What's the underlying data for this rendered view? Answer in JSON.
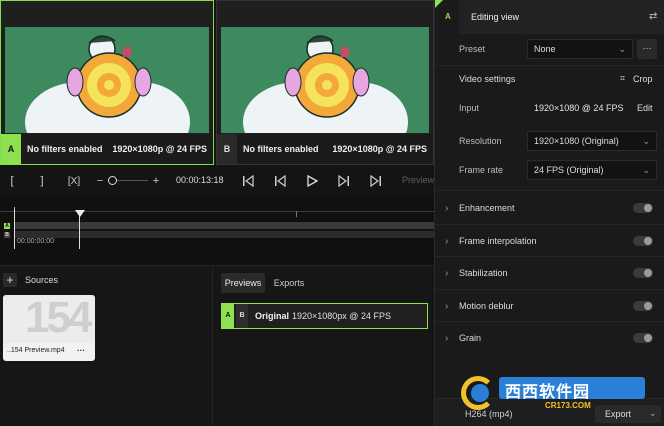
{
  "preview_a": {
    "badge": "A",
    "status": "No filters enabled",
    "resolution": "1920×1080p @ 24 FPS"
  },
  "preview_b": {
    "badge": "B",
    "status": "No filters enabled",
    "resolution": "1920×1080p @ 24 FPS"
  },
  "transport": {
    "in_label": "[",
    "out_label": "]",
    "clear_label": "[X]",
    "zoom_minus": "−",
    "zoom_plus": "+",
    "timecode": "00:00:13:18",
    "preview_label": "Preview"
  },
  "timeline": {
    "track_a": "A",
    "track_b": "B",
    "timecode": "00:00:00:00"
  },
  "sources": {
    "add_label": "+",
    "title": "Sources",
    "thumb_text": "154",
    "file_name": "..154 Preview.mp4",
    "more_label": "···"
  },
  "previews_panel": {
    "tabs": [
      "Previews",
      "Exports"
    ],
    "item": {
      "badge_a": "A",
      "badge_b": "B",
      "name": "Original",
      "resolution": "1920×1080px @ 24 FPS"
    }
  },
  "editing": {
    "badge": "A",
    "title": "Editing view",
    "preset_label": "Preset",
    "preset_value": "None",
    "more_label": "···",
    "video_settings_label": "Video settings",
    "crop_label": "Crop",
    "input_label": "Input",
    "input_value": "1920×1080 @ 24 FPS",
    "edit_label": "Edit",
    "resolution_label": "Resolution",
    "resolution_value": "1920×1080 (Original)",
    "framerate_label": "Frame rate",
    "framerate_value": "24 FPS (Original)",
    "sections": [
      {
        "label": "Enhancement",
        "enabled": false
      },
      {
        "label": "Frame interpolation",
        "enabled": false
      },
      {
        "label": "Stabilization",
        "enabled": false
      },
      {
        "label": "Motion deblur",
        "enabled": false
      },
      {
        "label": "Grain",
        "enabled": false
      }
    ]
  },
  "export": {
    "format": "H264 (mp4)",
    "button_label": "Export"
  },
  "watermark": {
    "text": "西西软件园",
    "url": "CR173.COM"
  },
  "colors": {
    "accent": "#8de04f",
    "frame_bg": "#3e8a5f"
  }
}
